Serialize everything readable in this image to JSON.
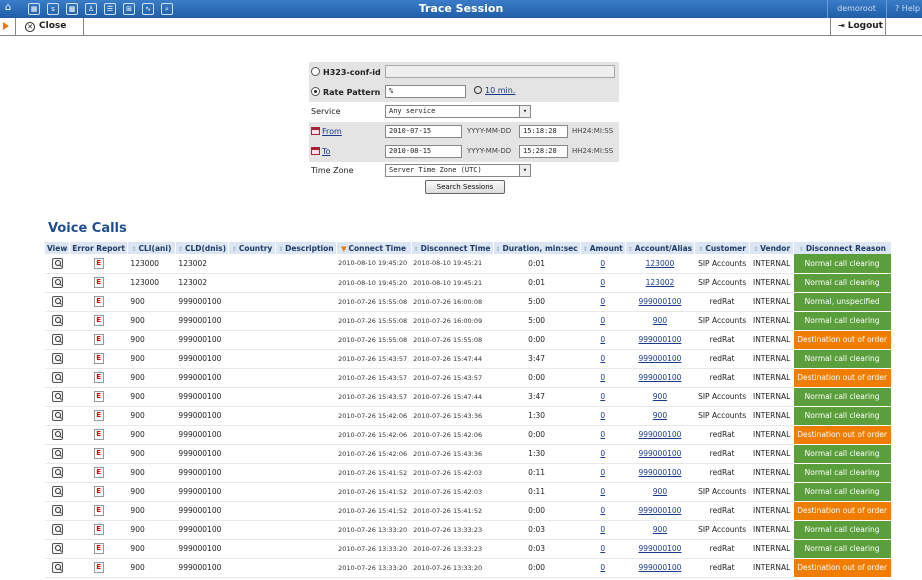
{
  "window": {
    "title": "Trace Session",
    "user": "demoroot",
    "help": "Help",
    "toolbar_icons": [
      "home-icon",
      "grid-icon",
      "s-icon",
      "grid2-icon",
      "user-icon",
      "list-icon",
      "tree-icon",
      "chart-icon",
      "search-icon"
    ]
  },
  "toolbar": {
    "close_label": "Close",
    "logout_label": "Logout"
  },
  "search_form": {
    "h323_label": "H323-conf-id",
    "h323_value": "",
    "rate_pattern_label": "Rate Pattern",
    "rate_pattern_value": "%",
    "duration_link": "10 min.",
    "service_label": "Service",
    "service_value": "Any service",
    "from_label": "From",
    "from_date": "2010-07-15",
    "from_time": "15:18:28",
    "to_label": "To",
    "to_date": "2010-08-15",
    "to_time": "15:28:28",
    "date_hint": "YYYY-MM-DD",
    "time_hint": "HH24:MI:SS",
    "timezone_label": "Time Zone",
    "timezone_value": "Server Time Zone (UTC)",
    "search_button": "Search Sessions"
  },
  "voice_calls": {
    "title": "Voice Calls",
    "columns": [
      "View",
      "Error Report",
      "CLI(ani)",
      "CLD(dnis)",
      "Country",
      "Description",
      "Connect Time",
      "Disconnect Time",
      "Duration, min:sec",
      "Amount",
      "Account/Alias",
      "Customer",
      "Vendor",
      "Disconnect Reason"
    ],
    "rows": [
      {
        "cli": "123000",
        "cld": "123002",
        "connect": "2010-08-10 19:45:20",
        "disconnect": "2010-08-10 19:45:21",
        "duration": "0:01",
        "amount": "0",
        "account": "123000",
        "customer": "SIP Accounts",
        "vendor": "INTERNAL",
        "reason": "Normal call clearing",
        "status": "ok"
      },
      {
        "cli": "123000",
        "cld": "123002",
        "connect": "2010-08-10 19:45:20",
        "disconnect": "2010-08-10 19:45:21",
        "duration": "0:01",
        "amount": "0",
        "account": "123002",
        "customer": "SIP Accounts",
        "vendor": "INTERNAL",
        "reason": "Normal call clearing",
        "status": "ok"
      },
      {
        "cli": "900",
        "cld": "999000100",
        "connect": "2010-07-26 15:55:08",
        "disconnect": "2010-07-26 16:00:08",
        "duration": "5:00",
        "amount": "0",
        "account": "999000100",
        "customer": "redRat",
        "vendor": "INTERNAL",
        "reason": "Normal, unspecified",
        "status": "ok"
      },
      {
        "cli": "900",
        "cld": "999000100",
        "connect": "2010-07-26 15:55:08",
        "disconnect": "2010-07-26 16:00:09",
        "duration": "5:00",
        "amount": "0",
        "account": "900",
        "customer": "SIP Accounts",
        "vendor": "INTERNAL",
        "reason": "Normal call clearing",
        "status": "ok"
      },
      {
        "cli": "900",
        "cld": "999000100",
        "connect": "2010-07-26 15:55:08",
        "disconnect": "2010-07-26 15:55:08",
        "duration": "0:00",
        "amount": "0",
        "account": "999000100",
        "customer": "redRat",
        "vendor": "INTERNAL",
        "reason": "Destination out of order",
        "status": "bad"
      },
      {
        "cli": "900",
        "cld": "999000100",
        "connect": "2010-07-26 15:43:57",
        "disconnect": "2010-07-26 15:47:44",
        "duration": "3:47",
        "amount": "0",
        "account": "999000100",
        "customer": "redRat",
        "vendor": "INTERNAL",
        "reason": "Normal call clearing",
        "status": "ok"
      },
      {
        "cli": "900",
        "cld": "999000100",
        "connect": "2010-07-26 15:43:57",
        "disconnect": "2010-07-26 15:43:57",
        "duration": "0:00",
        "amount": "0",
        "account": "999000100",
        "customer": "redRat",
        "vendor": "INTERNAL",
        "reason": "Destination out of order",
        "status": "bad"
      },
      {
        "cli": "900",
        "cld": "999000100",
        "connect": "2010-07-26 15:43:57",
        "disconnect": "2010-07-26 15:47:44",
        "duration": "3:47",
        "amount": "0",
        "account": "900",
        "customer": "SIP Accounts",
        "vendor": "INTERNAL",
        "reason": "Normal call clearing",
        "status": "ok"
      },
      {
        "cli": "900",
        "cld": "999000100",
        "connect": "2010-07-26 15:42:06",
        "disconnect": "2010-07-26 15:43:36",
        "duration": "1:30",
        "amount": "0",
        "account": "900",
        "customer": "SIP Accounts",
        "vendor": "INTERNAL",
        "reason": "Normal call clearing",
        "status": "ok"
      },
      {
        "cli": "900",
        "cld": "999000100",
        "connect": "2010-07-26 15:42:06",
        "disconnect": "2010-07-26 15:42:06",
        "duration": "0:00",
        "amount": "0",
        "account": "999000100",
        "customer": "redRat",
        "vendor": "INTERNAL",
        "reason": "Destination out of order",
        "status": "bad"
      },
      {
        "cli": "900",
        "cld": "999000100",
        "connect": "2010-07-26 15:42:06",
        "disconnect": "2010-07-26 15:43:36",
        "duration": "1:30",
        "amount": "0",
        "account": "999000100",
        "customer": "redRat",
        "vendor": "INTERNAL",
        "reason": "Normal call clearing",
        "status": "ok"
      },
      {
        "cli": "900",
        "cld": "999000100",
        "connect": "2010-07-26 15:41:52",
        "disconnect": "2010-07-26 15:42:03",
        "duration": "0:11",
        "amount": "0",
        "account": "999000100",
        "customer": "redRat",
        "vendor": "INTERNAL",
        "reason": "Normal call clearing",
        "status": "ok"
      },
      {
        "cli": "900",
        "cld": "999000100",
        "connect": "2010-07-26 15:41:52",
        "disconnect": "2010-07-26 15:42:03",
        "duration": "0:11",
        "amount": "0",
        "account": "900",
        "customer": "SIP Accounts",
        "vendor": "INTERNAL",
        "reason": "Normal call clearing",
        "status": "ok"
      },
      {
        "cli": "900",
        "cld": "999000100",
        "connect": "2010-07-26 15:41:52",
        "disconnect": "2010-07-26 15:41:52",
        "duration": "0:00",
        "amount": "0",
        "account": "999000100",
        "customer": "redRat",
        "vendor": "INTERNAL",
        "reason": "Destination out of order",
        "status": "bad"
      },
      {
        "cli": "900",
        "cld": "999000100",
        "connect": "2010-07-26 13:33:20",
        "disconnect": "2010-07-26 13:33:23",
        "duration": "0:03",
        "amount": "0",
        "account": "900",
        "customer": "SIP Accounts",
        "vendor": "INTERNAL",
        "reason": "Normal call clearing",
        "status": "ok"
      },
      {
        "cli": "900",
        "cld": "999000100",
        "connect": "2010-07-26 13:33:20",
        "disconnect": "2010-07-26 13:33:23",
        "duration": "0:03",
        "amount": "0",
        "account": "999000100",
        "customer": "redRat",
        "vendor": "INTERNAL",
        "reason": "Normal call clearing",
        "status": "ok"
      },
      {
        "cli": "900",
        "cld": "999000100",
        "connect": "2010-07-26 13:33:20",
        "disconnect": "2010-07-26 13:33:20",
        "duration": "0:00",
        "amount": "0",
        "account": "999000100",
        "customer": "redRat",
        "vendor": "INTERNAL",
        "reason": "Destination out of order",
        "status": "bad"
      }
    ]
  },
  "colors": {
    "header_blue": "#2a6bb8",
    "ok_green": "#5a9f3c",
    "bad_orange": "#f07d00",
    "sorted_arrow": "#e87c00"
  }
}
